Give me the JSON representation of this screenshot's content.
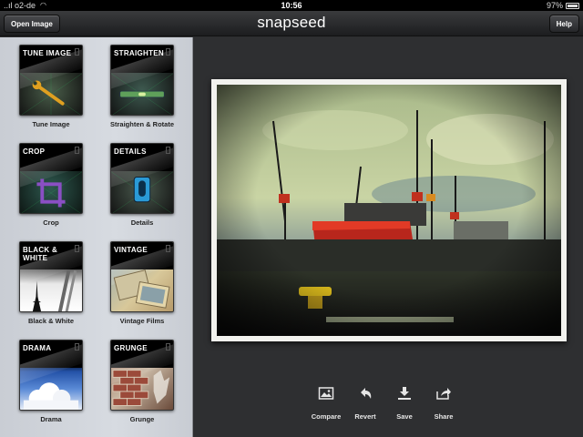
{
  "status_bar": {
    "carrier": "..ıl o2-de",
    "time": "10:56",
    "battery": "97%"
  },
  "toolbar": {
    "open_image": "Open Image",
    "app_title": "snapseed",
    "help": "Help"
  },
  "filters": [
    {
      "tile_title": "TUNE IMAGE",
      "label": "Tune Image",
      "icon": "wrench-icon"
    },
    {
      "tile_title": "STRAIGHTEN",
      "label": "Straighten & Rotate",
      "icon": "level-icon"
    },
    {
      "tile_title": "CROP",
      "label": "Crop",
      "icon": "crop-icon"
    },
    {
      "tile_title": "DETAILS",
      "label": "Details",
      "icon": "lens-icon"
    },
    {
      "tile_title": "BLACK & WHITE",
      "label": "Black & White",
      "icon": "eiffel-tower-icon"
    },
    {
      "tile_title": "VINTAGE",
      "label": "Vintage Films",
      "icon": "vintage-photo-icon"
    },
    {
      "tile_title": "DRAMA",
      "label": "Drama",
      "icon": "clouds-icon"
    },
    {
      "tile_title": "GRUNGE",
      "label": "Grunge",
      "icon": "brick-wall-icon"
    }
  ],
  "actions": [
    {
      "label": "Compare",
      "icon": "image-icon"
    },
    {
      "label": "Revert",
      "icon": "undo-arrow-icon"
    },
    {
      "label": "Save",
      "icon": "download-icon"
    },
    {
      "label": "Share",
      "icon": "share-icon"
    }
  ],
  "colors": {
    "toolbar": "#2a2b2d",
    "sidebar": "#d0d4da",
    "canvas": "#2e2f31",
    "crop_accent": "#8a4fc4",
    "wrench_accent": "#e0a020",
    "lens_accent": "#2a9ad6"
  }
}
